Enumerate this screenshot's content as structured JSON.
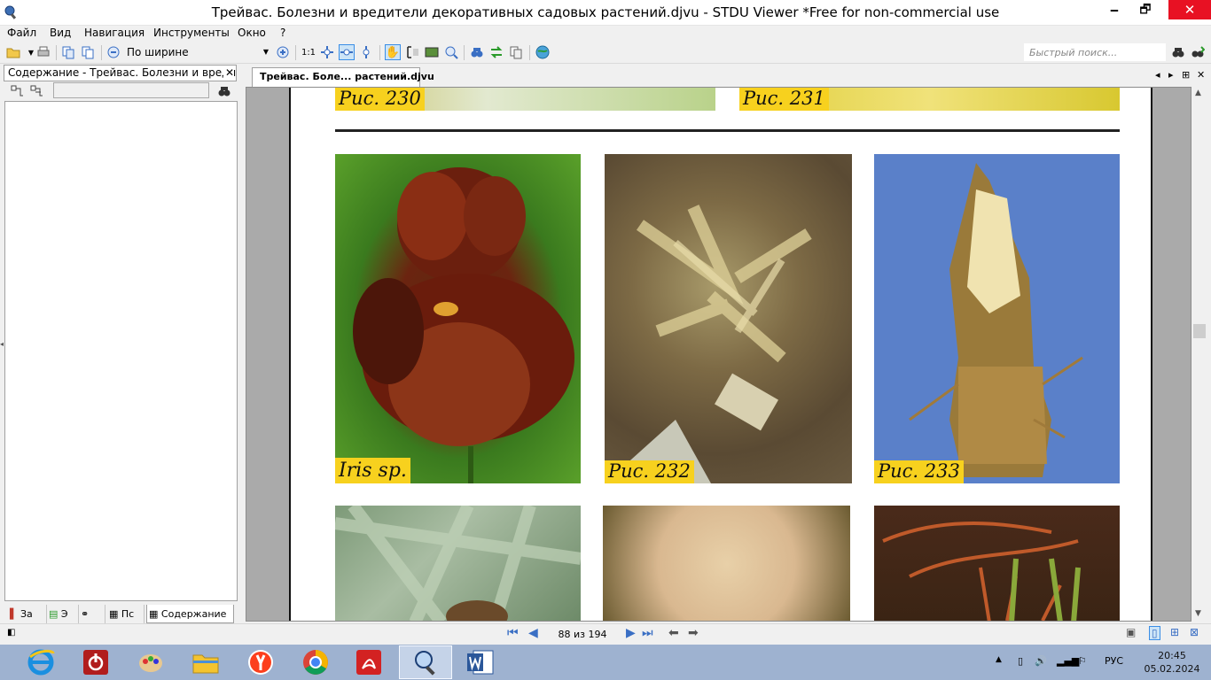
{
  "window": {
    "title": "Трейвас. Болезни и вредители декоративных садовых растений.djvu - STDU Viewer *Free for non-commercial use",
    "minimize": "🗕",
    "maximize": "🗗",
    "close": "✕"
  },
  "menu": [
    "Файл",
    "Вид",
    "Навигация",
    "Инструменты",
    "Окно",
    "?"
  ],
  "toolbar": {
    "zoom_mode": "По ширине",
    "actual_size": "1:1",
    "quick_search_placeholder": "Быстрый поиск..."
  },
  "sidebar": {
    "header": "Содержание - Трейвас. Болезни и вредители",
    "tabs": [
      "За",
      "Э",
      "",
      "Пс",
      "Содержание"
    ]
  },
  "document": {
    "tab_label": "Трейвас. Боле... растений.djvu",
    "captions": {
      "fig230": "Рис. 230",
      "fig231": "Рис. 231",
      "iris": "Iris sp.",
      "fig232": "Рис. 232",
      "fig233": "Рис. 233"
    }
  },
  "status": {
    "page_indicator": "88 из 194"
  },
  "taskbar": {
    "language": "РУС",
    "time": "20:45",
    "date": "05.02.2024"
  },
  "colors": {
    "caption_bg": "#f7d11e",
    "close_red": "#e81123",
    "taskbar": "#9eb2d0"
  }
}
